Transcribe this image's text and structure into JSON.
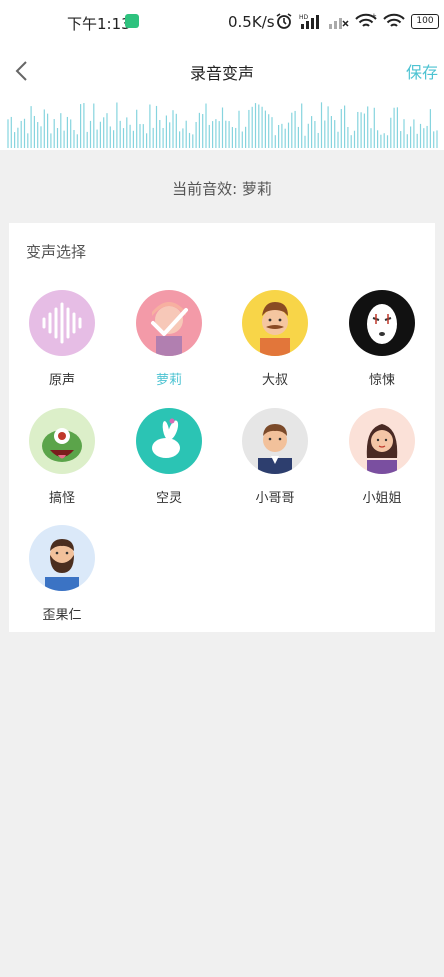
{
  "status": {
    "time": "下午1:13",
    "speed": "0.5K/s",
    "battery": "100"
  },
  "header": {
    "title": "录音变声",
    "save_label": "保存"
  },
  "current": {
    "label": "当前音效: 萝莉"
  },
  "panel": {
    "title": "变声选择",
    "effects": [
      {
        "label": "原声",
        "icon": "soundwave-icon",
        "selected": false
      },
      {
        "label": "萝莉",
        "icon": "girl-avatar-icon",
        "selected": true
      },
      {
        "label": "大叔",
        "icon": "uncle-avatar-icon",
        "selected": false
      },
      {
        "label": "惊悚",
        "icon": "ghost-mask-icon",
        "selected": false
      },
      {
        "label": "搞怪",
        "icon": "monster-icon",
        "selected": false
      },
      {
        "label": "空灵",
        "icon": "white-rabbit-icon",
        "selected": false
      },
      {
        "label": "小哥哥",
        "icon": "young-man-icon",
        "selected": false
      },
      {
        "label": "小姐姐",
        "icon": "young-woman-icon",
        "selected": false
      },
      {
        "label": "歪果仁",
        "icon": "foreign-man-icon",
        "selected": false
      }
    ]
  },
  "colors": {
    "accent": "#4dc3d2",
    "background": "#f0f0f0"
  }
}
